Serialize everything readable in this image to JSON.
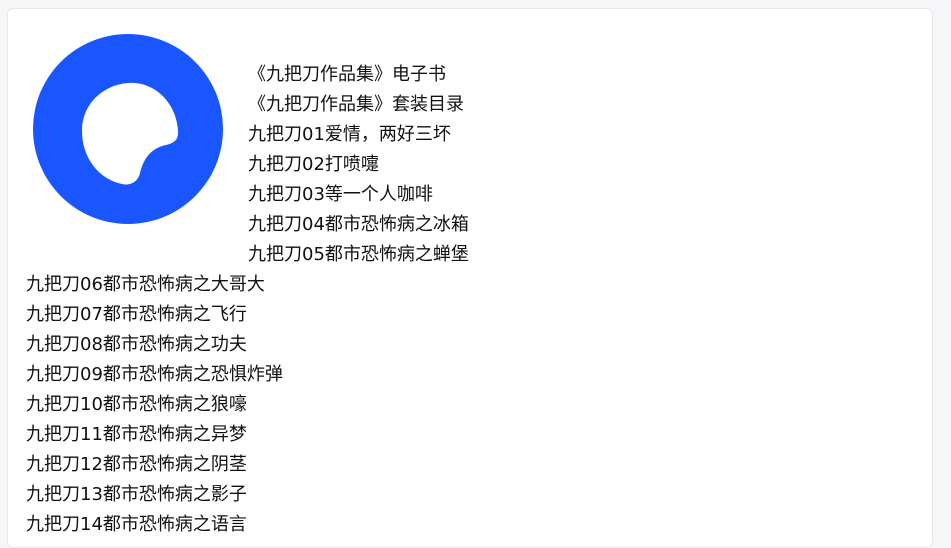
{
  "brand": {
    "logo_color": "#1a56ff",
    "logo_icon": "browser-logo-icon"
  },
  "items": [
    "《九把刀作品集》电子书",
    "《九把刀作品集》套装目录",
    "九把刀01爱情，两好三坏",
    "九把刀02打喷嚏",
    "九把刀03等一个人咖啡",
    "九把刀04都市恐怖病之冰箱",
    "九把刀05都市恐怖病之蝉堡",
    "九把刀06都市恐怖病之大哥大",
    "九把刀07都市恐怖病之飞行",
    "九把刀08都市恐怖病之功夫",
    "九把刀09都市恐怖病之恐惧炸弹",
    "九把刀10都市恐怖病之狼嚎",
    "九把刀11都市恐怖病之异梦",
    "九把刀12都市恐怖病之阴茎",
    "九把刀13都市恐怖病之影子",
    "九把刀14都市恐怖病之语言"
  ]
}
